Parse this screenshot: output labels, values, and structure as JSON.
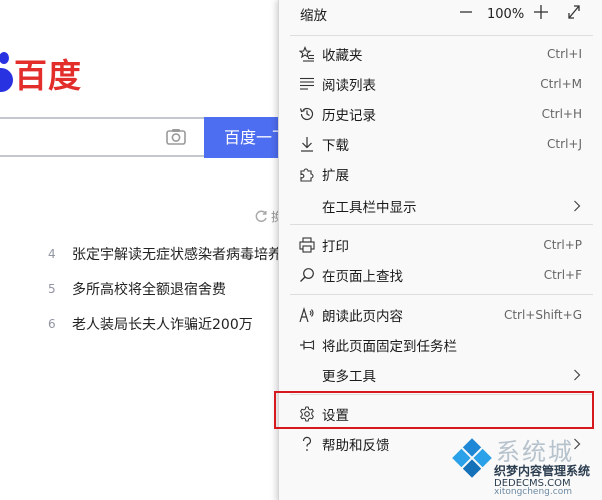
{
  "baidu": {
    "logo_text": "百度",
    "search_button": "百度一下",
    "search_value": "",
    "refresh_text": "换",
    "hot_items": [
      {
        "num": "4",
        "text": "张定宇解读无症状感染者病毒培养"
      },
      {
        "num": "5",
        "text": "多所高校将全额退宿舍费"
      },
      {
        "num": "6",
        "text": "老人装局长夫人诈骗近200万"
      }
    ]
  },
  "menu": {
    "zoom": {
      "label": "缩放",
      "minus": "—",
      "value": "100%",
      "plus": "+"
    },
    "items": [
      {
        "label": "收藏夹",
        "shortcut": "Ctrl+I"
      },
      {
        "label": "阅读列表",
        "shortcut": "Ctrl+M"
      },
      {
        "label": "历史记录",
        "shortcut": "Ctrl+H"
      },
      {
        "label": "下载",
        "shortcut": "Ctrl+J"
      },
      {
        "label": "扩展",
        "shortcut": ""
      },
      {
        "label": "在工具栏中显示",
        "shortcut": ""
      },
      {
        "label": "打印",
        "shortcut": "Ctrl+P"
      },
      {
        "label": "在页面上查找",
        "shortcut": "Ctrl+F"
      },
      {
        "label": "朗读此页内容",
        "shortcut": "Ctrl+Shift+G"
      },
      {
        "label": "将此页面固定到任务栏",
        "shortcut": ""
      },
      {
        "label": "更多工具",
        "shortcut": ""
      },
      {
        "label": "设置",
        "shortcut": ""
      },
      {
        "label": "帮助和反馈",
        "shortcut": ""
      }
    ]
  },
  "colors": {
    "accent": "#4e6ef2",
    "logo_red": "#e22d2b",
    "highlight": "#d7191f",
    "menu_bg": "#f9f9f9"
  },
  "watermark": {
    "big": "系统城",
    "mid": "织梦内容管理系统",
    "domain": "DEDECMS.COM",
    "url": "xitongcheng.com"
  }
}
